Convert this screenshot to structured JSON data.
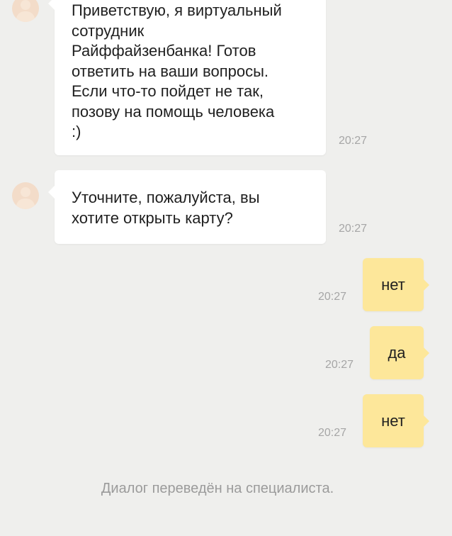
{
  "messages": [
    {
      "sender": "bot",
      "text": "Приветствую, я виртуальный сотрудник Райффайзенбанка! Готов ответить на ваши вопросы. Если что-то пойдет не так, позову на помощь человека :)",
      "lines": [
        "Приветствую, я виртуальный",
        "сотрудник",
        "Райффайзенбанка! Готов",
        "ответить на ваши вопросы.",
        "Если что-то пойдет не так,",
        "позову на помощь человека",
        ":)"
      ],
      "time": "20:27"
    },
    {
      "sender": "bot",
      "text": "Уточните, пожалуйста, вы хотите открыть карту?",
      "lines": [
        "Уточните, пожалуйста, вы",
        "хотите открыть карту?"
      ],
      "time": "20:27"
    },
    {
      "sender": "user",
      "text": "нет",
      "time": "20:27"
    },
    {
      "sender": "user",
      "text": "да",
      "time": "20:27"
    },
    {
      "sender": "user",
      "text": "нет",
      "time": "20:27"
    }
  ],
  "system_notice": "Диалог переведён на специалиста.",
  "colors": {
    "background": "#efefed",
    "bot_bubble": "#ffffff",
    "user_bubble": "#fde79a",
    "timestamp": "#a6a6a6",
    "system_text": "#9b9b9b",
    "avatar": "#f3dcc9"
  },
  "icons": {
    "bot_avatar": "person-silhouette-icon"
  }
}
